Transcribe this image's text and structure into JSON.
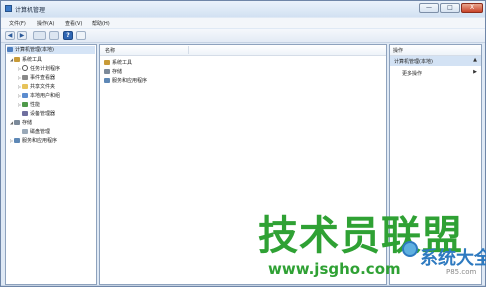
{
  "window": {
    "title": "计算机管理"
  },
  "title_buttons": {
    "minimize": "—",
    "maximize": "□",
    "close": "X"
  },
  "menu": [
    "文件(F)",
    "操作(A)",
    "查看(V)",
    "帮助(H)"
  ],
  "toolbar": {
    "back": "◀",
    "forward": "▶",
    "help": "?"
  },
  "tree": {
    "root": "计算机管理(本地)",
    "system_tools": "系统工具",
    "task_scheduler": "任务计划程序",
    "event_viewer": "事件查看器",
    "shared_folders": "共享文件夹",
    "local_users": "本地用户和组",
    "performance": "性能",
    "device_manager": "设备管理器",
    "storage": "存储",
    "disk_management": "磁盘管理",
    "services_apps": "服务和应用程序"
  },
  "list": {
    "header_name": "名称",
    "rows": [
      "系统工具",
      "存储",
      "服务和应用程序"
    ]
  },
  "actions": {
    "header": "操作",
    "section": "计算机管理(本地)",
    "section_caret": "▲",
    "more": "更多操作",
    "more_arrow": "▶"
  },
  "watermark": {
    "main": "技术员联盟",
    "side": "系统大全",
    "url": "www.jsgho.com",
    "url2": "P85.com"
  }
}
